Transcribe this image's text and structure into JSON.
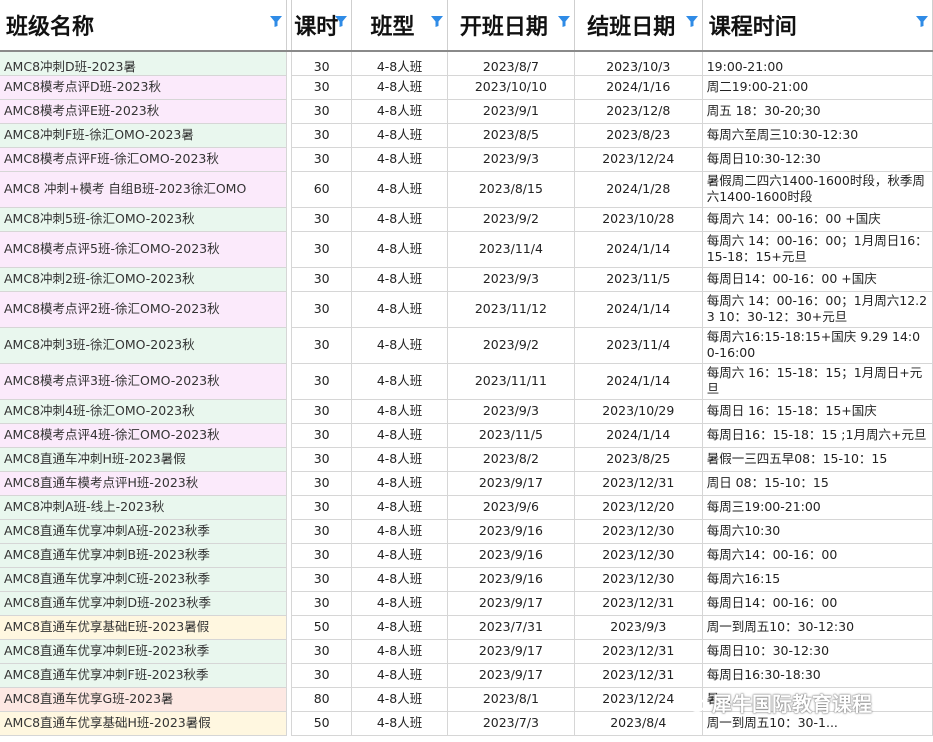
{
  "headers": {
    "name": "班级名称",
    "lessons": "课时",
    "type": "班型",
    "start": "开班日期",
    "end": "结班日期",
    "time": "课程时间"
  },
  "colors": {
    "green": "#e9f7ee",
    "pink": "#fbeafb",
    "yellow": "#fff7e0",
    "red": "#fde8e3",
    "filter": "#2f8be6"
  },
  "rows": [
    {
      "name": "AMC8冲刺D班-2023暑",
      "lessons": "30",
      "type": "4-8人班",
      "start": "2023/8/7",
      "end": "2023/10/3",
      "time": "19:00-21:00",
      "color": "green"
    },
    {
      "name": "AMC8模考点评D班-2023秋",
      "lessons": "30",
      "type": "4-8人班",
      "start": "2023/10/10",
      "end": "2024/1/16",
      "time": "周二19:00-21:00",
      "color": "pink"
    },
    {
      "name": "AMC8模考点评E班-2023秋",
      "lessons": "30",
      "type": "4-8人班",
      "start": "2023/9/1",
      "end": "2023/12/8",
      "time": "周五 18：30-20;30",
      "color": "pink"
    },
    {
      "name": "AMC8冲刺F班-徐汇OMO-2023暑",
      "lessons": "30",
      "type": "4-8人班",
      "start": "2023/8/5",
      "end": "2023/8/23",
      "time": "每周六至周三10:30-12:30",
      "color": "green"
    },
    {
      "name": "AMC8模考点评F班-徐汇OMO-2023秋",
      "lessons": "30",
      "type": "4-8人班",
      "start": "2023/9/3",
      "end": "2023/12/24",
      "time": "每周日10:30-12:30",
      "color": "pink"
    },
    {
      "name": "AMC8 冲刺+模考 自组B班-2023徐汇OMO",
      "lessons": "60",
      "type": "4-8人班",
      "start": "2023/8/15",
      "end": "2024/1/28",
      "time": "暑假周二四六1400-1600时段，秋季周六1400-1600时段",
      "color": "pink"
    },
    {
      "name": "AMC8冲刺5班-徐汇OMO-2023秋",
      "lessons": "30",
      "type": "4-8人班",
      "start": "2023/9/2",
      "end": "2023/10/28",
      "time": "每周六 14：00-16：00 +国庆",
      "color": "green"
    },
    {
      "name": "AMC8模考点评5班-徐汇OMO-2023秋",
      "lessons": "30",
      "type": "4-8人班",
      "start": "2023/11/4",
      "end": "2024/1/14",
      "time": "每周六 14：00-16：00；1月周日16：15-18：15+元旦",
      "color": "pink"
    },
    {
      "name": "AMC8冲刺2班-徐汇OMO-2023秋",
      "lessons": "30",
      "type": "4-8人班",
      "start": "2023/9/3",
      "end": "2023/11/5",
      "time": "每周日14：00-16：00 +国庆",
      "color": "green"
    },
    {
      "name": "AMC8模考点评2班-徐汇OMO-2023秋",
      "lessons": "30",
      "type": "4-8人班",
      "start": "2023/11/12",
      "end": "2024/1/14",
      "time": "每周六 14：00-16：00；1月周六12.23 10：30-12：30+元旦",
      "color": "pink"
    },
    {
      "name": "AMC8冲刺3班-徐汇OMO-2023秋",
      "lessons": "30",
      "type": "4-8人班",
      "start": "2023/9/2",
      "end": "2023/11/4",
      "time": "每周六16:15-18:15+国庆 9.29 14:00-16:00",
      "color": "green"
    },
    {
      "name": "AMC8模考点评3班-徐汇OMO-2023秋",
      "lessons": "30",
      "type": "4-8人班",
      "start": "2023/11/11",
      "end": "2024/1/14",
      "time": "每周六 16：15-18：15；1月周日+元旦",
      "color": "pink"
    },
    {
      "name": "AMC8冲刺4班-徐汇OMO-2023秋",
      "lessons": "30",
      "type": "4-8人班",
      "start": "2023/9/3",
      "end": "2023/10/29",
      "time": "每周日 16：15-18：15+国庆",
      "color": "green"
    },
    {
      "name": "AMC8模考点评4班-徐汇OMO-2023秋",
      "lessons": "30",
      "type": "4-8人班",
      "start": "2023/11/5",
      "end": "2024/1/14",
      "time": "每周日16：15-18：15 ;1月周六+元旦",
      "color": "pink"
    },
    {
      "name": "AMC8直通车冲刺H班-2023暑假",
      "lessons": "30",
      "type": "4-8人班",
      "start": "2023/8/2",
      "end": "2023/8/25",
      "time": "暑假一三四五早08：15-10：15",
      "color": "green"
    },
    {
      "name": "AMC8直通车模考点评H班-2023秋",
      "lessons": "30",
      "type": "4-8人班",
      "start": "2023/9/17",
      "end": "2023/12/31",
      "time": "周日 08：15-10：15",
      "color": "pink"
    },
    {
      "name": "AMC8冲刺A班-线上-2023秋",
      "lessons": "30",
      "type": "4-8人班",
      "start": "2023/9/6",
      "end": "2023/12/20",
      "time": "每周三19:00-21:00",
      "color": "green"
    },
    {
      "name": "AMC8直通车优享冲刺A班-2023秋季",
      "lessons": "30",
      "type": "4-8人班",
      "start": "2023/9/16",
      "end": "2023/12/30",
      "time": "每周六10:30",
      "color": "green"
    },
    {
      "name": "AMC8直通车优享冲刺B班-2023秋季",
      "lessons": "30",
      "type": "4-8人班",
      "start": "2023/9/16",
      "end": "2023/12/30",
      "time": "每周六14：00-16：00",
      "color": "green"
    },
    {
      "name": "AMC8直通车优享冲刺C班-2023秋季",
      "lessons": "30",
      "type": "4-8人班",
      "start": "2023/9/16",
      "end": "2023/12/30",
      "time": "每周六16:15",
      "color": "green"
    },
    {
      "name": "AMC8直通车优享冲刺D班-2023秋季",
      "lessons": "30",
      "type": "4-8人班",
      "start": "2023/9/17",
      "end": "2023/12/31",
      "time": "每周日14：00-16：00",
      "color": "green"
    },
    {
      "name": "AMC8直通车优享基础E班-2023暑假",
      "lessons": "50",
      "type": "4-8人班",
      "start": "2023/7/31",
      "end": "2023/9/3",
      "time": "周一到周五10：30-12:30",
      "color": "yellow"
    },
    {
      "name": "AMC8直通车优享冲刺E班-2023秋季",
      "lessons": "30",
      "type": "4-8人班",
      "start": "2023/9/17",
      "end": "2023/12/31",
      "time": "每周日10：30-12:30",
      "color": "green"
    },
    {
      "name": "AMC8直通车优享冲刺F班-2023秋季",
      "lessons": "30",
      "type": "4-8人班",
      "start": "2023/9/17",
      "end": "2023/12/31",
      "time": "每周日16:30-18:30",
      "color": "green"
    },
    {
      "name": "AMC8直通车优享G班-2023暑",
      "lessons": "80",
      "type": "4-8人班",
      "start": "2023/8/1",
      "end": "2023/12/24",
      "time": "暑...",
      "color": "red"
    },
    {
      "name": "AMC8直通车优享基础H班-2023暑假",
      "lessons": "50",
      "type": "4-8人班",
      "start": "2023/7/3",
      "end": "2023/8/4",
      "time": "周一到周五10：30-1...",
      "color": "yellow"
    }
  ],
  "watermark": "犀牛国际教育课程"
}
